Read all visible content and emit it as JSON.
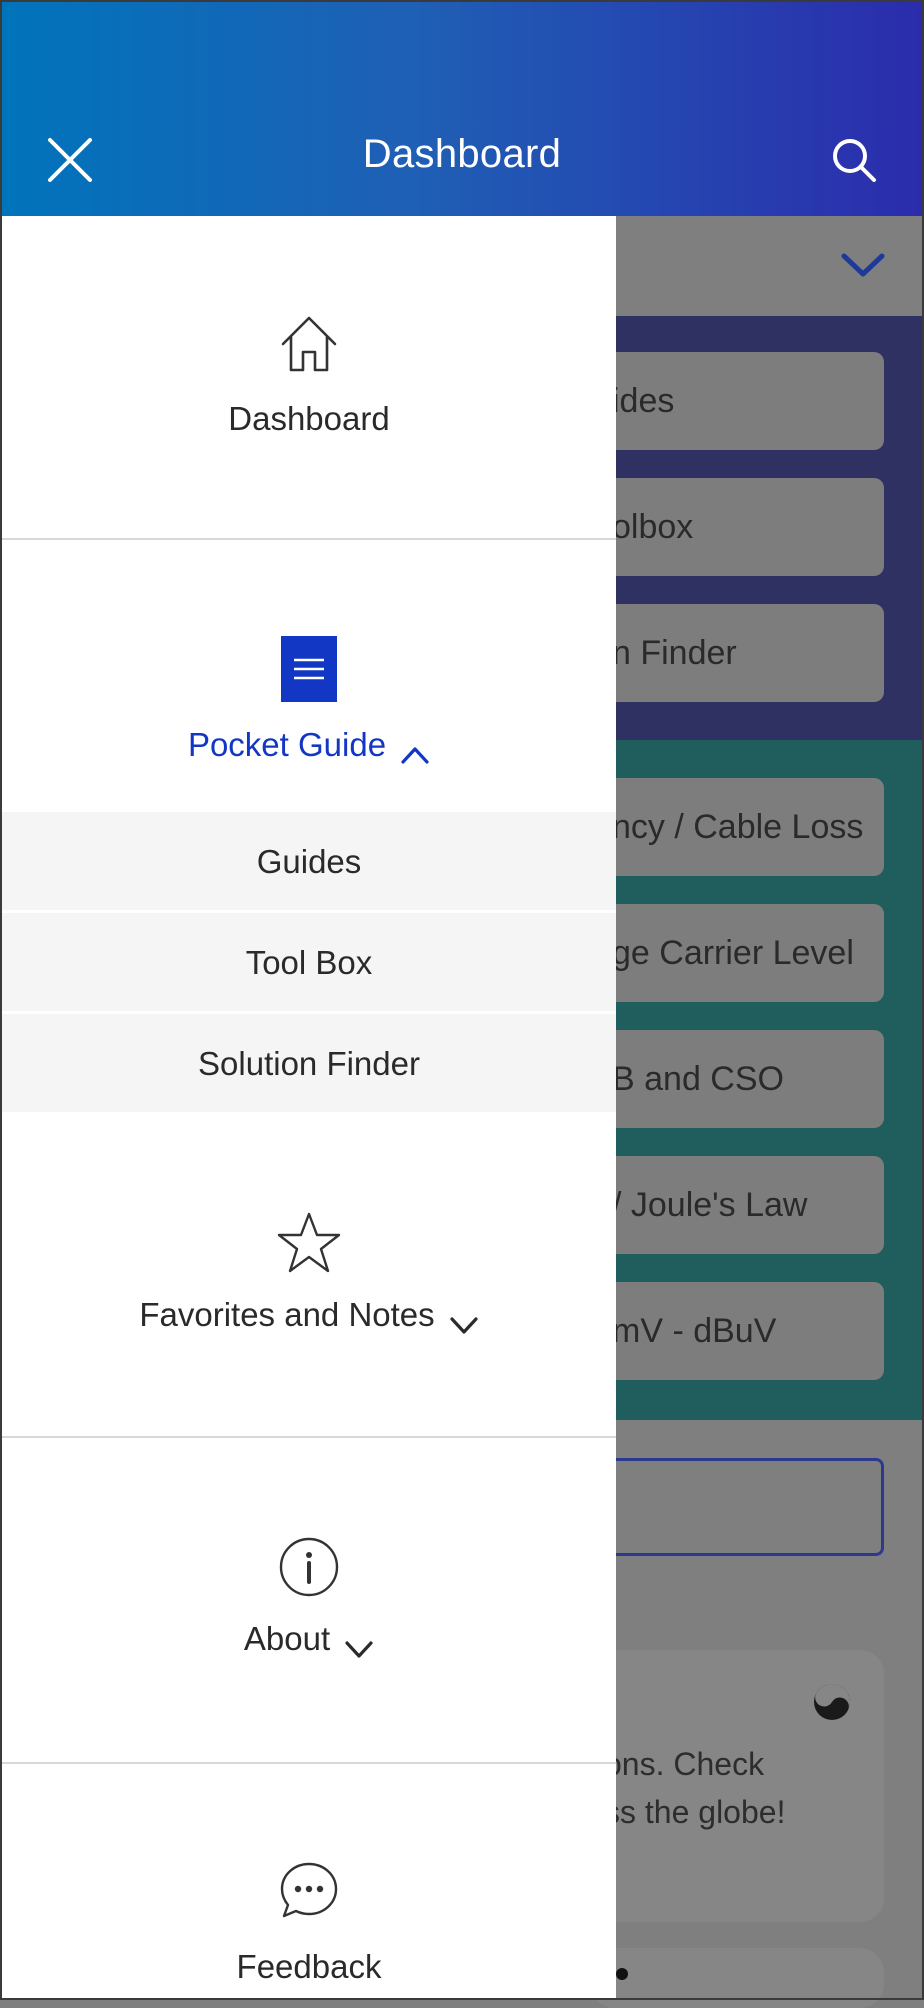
{
  "header": {
    "title": "Dashboard",
    "close_icon": "close-icon",
    "search_icon": "search-icon",
    "gradient_start": "#0074bb",
    "gradient_end": "#2b2cac"
  },
  "drawer": {
    "dashboard": {
      "label": "Dashboard",
      "icon": "home-icon"
    },
    "pocket_guide": {
      "label": "Pocket Guide",
      "icon": "menu-list-icon",
      "expanded": true,
      "active_color": "#1237c5",
      "items": [
        {
          "label": "Guides"
        },
        {
          "label": "Tool Box"
        },
        {
          "label": "Solution Finder"
        }
      ]
    },
    "favorites": {
      "label": "Favorites and Notes",
      "icon": "star-icon"
    },
    "about": {
      "label": "About",
      "icon": "info-icon"
    },
    "feedback": {
      "label": "Feedback",
      "icon": "chat-bubble-icon"
    }
  },
  "background": {
    "blue_buttons": [
      "ides",
      "olbox",
      "n Finder"
    ],
    "teal_buttons": [
      "ncy / Cable Loss",
      "ge Carrier Level",
      "B and CSO",
      "/ Joule's Law",
      "mV - dBuV"
    ],
    "card_lines": [
      "ons. Check",
      "ss the globe!"
    ]
  }
}
